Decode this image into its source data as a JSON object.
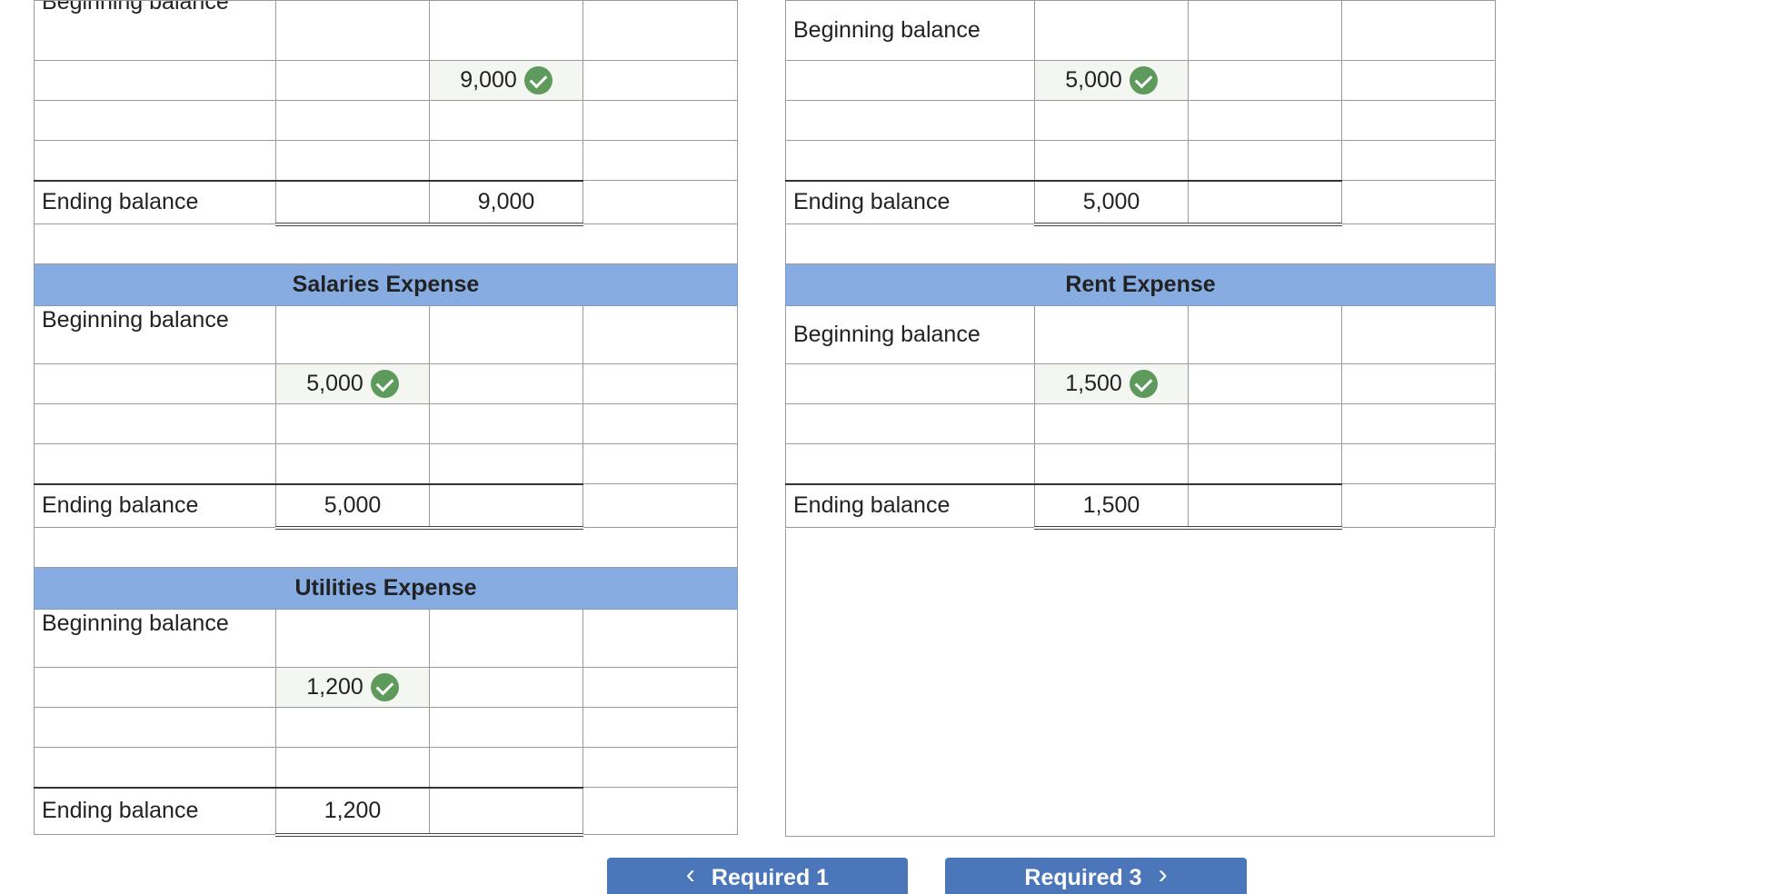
{
  "left": {
    "top_account": {
      "beginning_label": "Beginning balance",
      "entry_value": "9,000",
      "ending_label": "Ending balance",
      "ending_value": "9,000"
    },
    "salaries": {
      "title": "Salaries Expense",
      "beginning_label": "Beginning balance",
      "entry_value": "5,000",
      "ending_label": "Ending balance",
      "ending_value": "5,000"
    },
    "utilities": {
      "title": "Utilities Expense",
      "beginning_label": "Beginning balance",
      "entry_value": "1,200",
      "ending_label": "Ending balance",
      "ending_value": "1,200"
    }
  },
  "right": {
    "top_account": {
      "beginning_label": "Beginning balance",
      "entry_value": "5,000",
      "ending_label": "Ending balance",
      "ending_value": "5,000"
    },
    "rent": {
      "title": "Rent Expense",
      "beginning_label": "Beginning balance",
      "entry_value": "1,500",
      "ending_label": "Ending balance",
      "ending_value": "1,500"
    }
  },
  "nav": {
    "prev_label": "Required 1",
    "next_label": "Required 3"
  },
  "colors": {
    "header_bg": "#86ace2",
    "check_green": "#5e9a5c",
    "nav_blue": "#4b76b9"
  }
}
